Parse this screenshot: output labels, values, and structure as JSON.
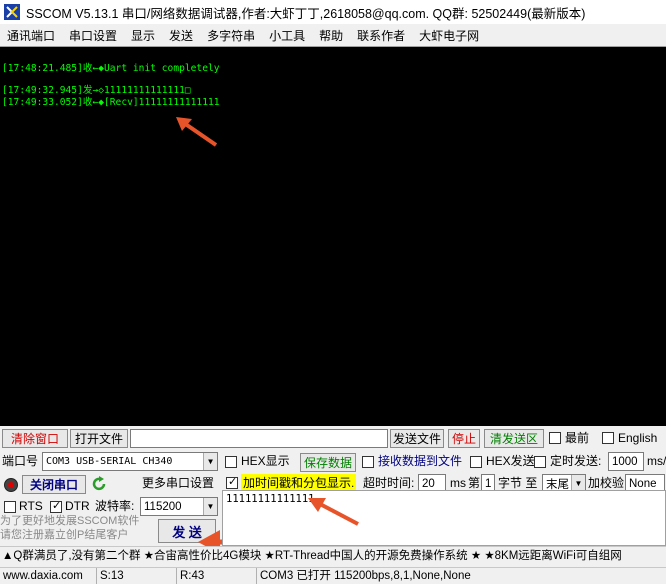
{
  "window": {
    "title": "SSCOM V5.13.1 串口/网络数据调试器,作者:大虾丁丁,2618058@qq.com. QQ群: 52502449(最新版本)"
  },
  "menu": [
    "通讯端口",
    "串口设置",
    "显示",
    "发送",
    "多字符串",
    "小工具",
    "帮助",
    "联系作者",
    "大虾电子网"
  ],
  "terminal": {
    "lines": [
      "[17:48:21.485]收←◆Uart init completely",
      "[17:49:32.945]发→◇11111111111111□",
      "[17:49:33.052]收←◆[Recv]11111111111111"
    ]
  },
  "toolbar": {
    "clear_window": "清除窗口",
    "open_file": "打开文件",
    "file_path": "",
    "send_file": "发送文件",
    "stop": "停止",
    "clear_send": "清发送区",
    "topmost": "最前",
    "english": "English"
  },
  "port": {
    "label": "端口号",
    "value": "COM3 USB-SERIAL CH340",
    "hex_display": "HEX显示",
    "save_data": "保存数据",
    "recv_to_file": "接收数据到文件",
    "hex_send": "HEX发送",
    "timed_send": "定时发送:",
    "interval": "1000",
    "interval_unit": "ms/"
  },
  "serial": {
    "close_port": "关闭串口",
    "more_settings": "更多串口设置",
    "timestamp": "加时间戳和分包显示.",
    "timeout_label": "超时时间:",
    "timeout": "20",
    "timeout_unit": "ms",
    "nth_label": "第",
    "nth_value": "1",
    "byte_label": "字节 至",
    "end_value": "末尾",
    "checksum_label": "加校验",
    "checksum_value": "None"
  },
  "flow": {
    "rts": "RTS",
    "dtr": "DTR",
    "baud_label": "波特率:",
    "baud": "115200"
  },
  "promo": {
    "line1": "为了更好地发展SSCOM软件",
    "line2": "请您注册嘉立创P结尾客户",
    "send": "发 送"
  },
  "send_area": {
    "text": "11111111111111"
  },
  "marquee": "▲Q群满员了,没有第二个群 ★合宙高性价比4G模块 ★RT-Thread中国人的开源免费操作系统 ★ ★8KM远距离WiFi可自组网",
  "status": {
    "website": "www.daxia.com",
    "sent": "S:13",
    "received": "R:43",
    "port_status": "COM3 已打开  115200bps,8,1,None,None"
  },
  "colors": {
    "terminal_bg": "#000000",
    "terminal_text": "#00ff00",
    "annotation_arrow": "#e8542a",
    "highlight": "#ffff00"
  }
}
